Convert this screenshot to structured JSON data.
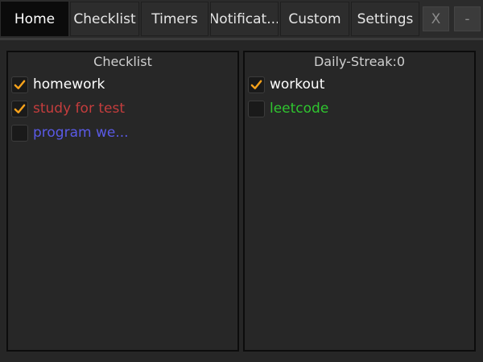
{
  "tabs": [
    {
      "label": "Home",
      "active": true
    },
    {
      "label": "Checklist",
      "active": false
    },
    {
      "label": "Timers",
      "active": false
    },
    {
      "label": "Notificat...",
      "active": false
    },
    {
      "label": "Custom",
      "active": false
    },
    {
      "label": "Settings",
      "active": false
    }
  ],
  "window_controls": {
    "close_label": "X",
    "minimize_label": "-"
  },
  "checklist_panel": {
    "title": "Checklist",
    "items": [
      {
        "label": "homework",
        "checked": true,
        "color": "#ffffff"
      },
      {
        "label": "study for test",
        "checked": true,
        "color": "#c43d3d"
      },
      {
        "label": "program we...",
        "checked": false,
        "color": "#5a5ae6"
      }
    ]
  },
  "daily_panel": {
    "title": "Daily-Streak:0",
    "items": [
      {
        "label": "workout",
        "checked": true,
        "color": "#ffffff"
      },
      {
        "label": "leetcode",
        "checked": false,
        "color": "#2fc52f"
      }
    ]
  },
  "colors": {
    "check_accent": "#f7a21b",
    "background": "#262626",
    "active_tab": "#0b0b0b"
  }
}
